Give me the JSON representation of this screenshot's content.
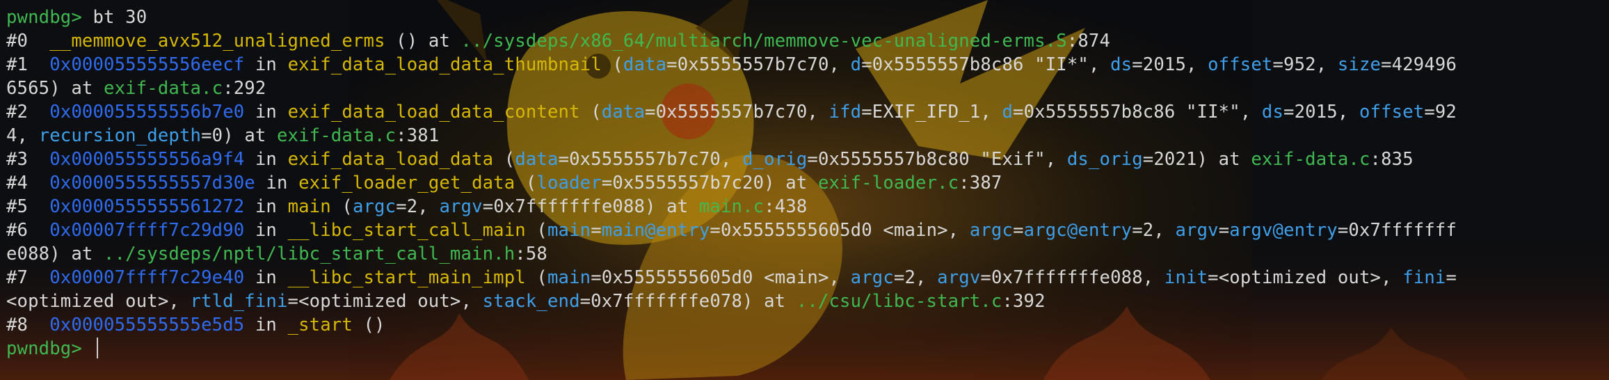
{
  "terminal": {
    "prompt": "pwndbg>",
    "command": "bt 30",
    "lines": [
      {
        "kind": "prompt",
        "segments": [
          {
            "t": "pwndbg>",
            "c": "pr"
          },
          {
            "t": " bt 30",
            "c": "w"
          }
        ]
      },
      {
        "kind": "frame",
        "segments": [
          {
            "t": "#0  ",
            "c": "w"
          },
          {
            "t": "__memmove_avx512_unaligned_erms",
            "c": "y"
          },
          {
            "t": " () at ",
            "c": "w"
          },
          {
            "t": "../sysdeps/x86_64/multiarch/memmove-vec-unaligned-erms.S",
            "c": "g"
          },
          {
            "t": ":874",
            "c": "w"
          }
        ]
      },
      {
        "kind": "frame",
        "segments": [
          {
            "t": "#1  ",
            "c": "w"
          },
          {
            "t": "0x000055555556eecf",
            "c": "a"
          },
          {
            "t": " in ",
            "c": "w"
          },
          {
            "t": "exif_data_load_data_thumbnail",
            "c": "y"
          },
          {
            "t": " (",
            "c": "w"
          },
          {
            "t": "data",
            "c": "b"
          },
          {
            "t": "=0x5555557b7c70, ",
            "c": "w"
          },
          {
            "t": "d",
            "c": "b"
          },
          {
            "t": "=0x5555557b8c86 \"II*\", ",
            "c": "w"
          },
          {
            "t": "ds",
            "c": "b"
          },
          {
            "t": "=2015, ",
            "c": "w"
          },
          {
            "t": "offset",
            "c": "b"
          },
          {
            "t": "=952, ",
            "c": "w"
          },
          {
            "t": "size",
            "c": "b"
          },
          {
            "t": "=429496",
            "c": "w"
          }
        ]
      },
      {
        "kind": "cont",
        "segments": [
          {
            "t": "6565) at ",
            "c": "w"
          },
          {
            "t": "exif-data.c",
            "c": "g"
          },
          {
            "t": ":292",
            "c": "w"
          }
        ]
      },
      {
        "kind": "frame",
        "segments": [
          {
            "t": "#2  ",
            "c": "w"
          },
          {
            "t": "0x000055555556b7e0",
            "c": "a"
          },
          {
            "t": " in ",
            "c": "w"
          },
          {
            "t": "exif_data_load_data_content",
            "c": "y"
          },
          {
            "t": " (",
            "c": "w"
          },
          {
            "t": "data",
            "c": "b"
          },
          {
            "t": "=0x5555557b7c70, ",
            "c": "w"
          },
          {
            "t": "ifd",
            "c": "b"
          },
          {
            "t": "=EXIF_IFD_1, ",
            "c": "w"
          },
          {
            "t": "d",
            "c": "b"
          },
          {
            "t": "=0x5555557b8c86 \"II*\", ",
            "c": "w"
          },
          {
            "t": "ds",
            "c": "b"
          },
          {
            "t": "=2015, ",
            "c": "w"
          },
          {
            "t": "offset",
            "c": "b"
          },
          {
            "t": "=92",
            "c": "w"
          }
        ]
      },
      {
        "kind": "cont",
        "segments": [
          {
            "t": "4, ",
            "c": "w"
          },
          {
            "t": "recursion_depth",
            "c": "b"
          },
          {
            "t": "=0) at ",
            "c": "w"
          },
          {
            "t": "exif-data.c",
            "c": "g"
          },
          {
            "t": ":381",
            "c": "w"
          }
        ]
      },
      {
        "kind": "frame",
        "segments": [
          {
            "t": "#3  ",
            "c": "w"
          },
          {
            "t": "0x000055555556a9f4",
            "c": "a"
          },
          {
            "t": " in ",
            "c": "w"
          },
          {
            "t": "exif_data_load_data",
            "c": "y"
          },
          {
            "t": " (",
            "c": "w"
          },
          {
            "t": "data",
            "c": "b"
          },
          {
            "t": "=0x5555557b7c70, ",
            "c": "w"
          },
          {
            "t": "d_orig",
            "c": "b"
          },
          {
            "t": "=0x5555557b8c80 \"Exif\", ",
            "c": "w"
          },
          {
            "t": "ds_orig",
            "c": "b"
          },
          {
            "t": "=2021) at ",
            "c": "w"
          },
          {
            "t": "exif-data.c",
            "c": "g"
          },
          {
            "t": ":835",
            "c": "w"
          }
        ]
      },
      {
        "kind": "frame",
        "segments": [
          {
            "t": "#4  ",
            "c": "w"
          },
          {
            "t": "0x0000555555557d30e",
            "c": "a"
          },
          {
            "t": " in ",
            "c": "w"
          },
          {
            "t": "exif_loader_get_data",
            "c": "y"
          },
          {
            "t": " (",
            "c": "w"
          },
          {
            "t": "loader",
            "c": "b"
          },
          {
            "t": "=0x5555557b7c20) at ",
            "c": "w"
          },
          {
            "t": "exif-loader.c",
            "c": "g"
          },
          {
            "t": ":387",
            "c": "w"
          }
        ]
      },
      {
        "kind": "frame",
        "segments": [
          {
            "t": "#5  ",
            "c": "w"
          },
          {
            "t": "0x0000555555561272",
            "c": "a"
          },
          {
            "t": " in ",
            "c": "w"
          },
          {
            "t": "main",
            "c": "y"
          },
          {
            "t": " (",
            "c": "w"
          },
          {
            "t": "argc",
            "c": "b"
          },
          {
            "t": "=2, ",
            "c": "w"
          },
          {
            "t": "argv",
            "c": "b"
          },
          {
            "t": "=0x7fffffffe088) at ",
            "c": "w"
          },
          {
            "t": "main.c",
            "c": "g"
          },
          {
            "t": ":438",
            "c": "w"
          }
        ]
      },
      {
        "kind": "frame",
        "segments": [
          {
            "t": "#6  ",
            "c": "w"
          },
          {
            "t": "0x00007ffff7c29d90",
            "c": "a"
          },
          {
            "t": " in ",
            "c": "w"
          },
          {
            "t": "__libc_start_call_main",
            "c": "y"
          },
          {
            "t": " (",
            "c": "w"
          },
          {
            "t": "main",
            "c": "b"
          },
          {
            "t": "=",
            "c": "w"
          },
          {
            "t": "main@entry",
            "c": "b"
          },
          {
            "t": "=0x5555555605d0 <main>, ",
            "c": "w"
          },
          {
            "t": "argc",
            "c": "b"
          },
          {
            "t": "=",
            "c": "w"
          },
          {
            "t": "argc@entry",
            "c": "b"
          },
          {
            "t": "=2, ",
            "c": "w"
          },
          {
            "t": "argv",
            "c": "b"
          },
          {
            "t": "=",
            "c": "w"
          },
          {
            "t": "argv@entry",
            "c": "b"
          },
          {
            "t": "=0x7fffffff",
            "c": "w"
          }
        ]
      },
      {
        "kind": "cont",
        "segments": [
          {
            "t": "e088) at ",
            "c": "w"
          },
          {
            "t": "../sysdeps/nptl/libc_start_call_main.h",
            "c": "g"
          },
          {
            "t": ":58",
            "c": "w"
          }
        ]
      },
      {
        "kind": "frame",
        "segments": [
          {
            "t": "#7  ",
            "c": "w"
          },
          {
            "t": "0x00007ffff7c29e40",
            "c": "a"
          },
          {
            "t": " in ",
            "c": "w"
          },
          {
            "t": "__libc_start_main_impl",
            "c": "y"
          },
          {
            "t": " (",
            "c": "w"
          },
          {
            "t": "main",
            "c": "b"
          },
          {
            "t": "=0x5555555605d0 <main>, ",
            "c": "w"
          },
          {
            "t": "argc",
            "c": "b"
          },
          {
            "t": "=2, ",
            "c": "w"
          },
          {
            "t": "argv",
            "c": "b"
          },
          {
            "t": "=0x7fffffffe088, ",
            "c": "w"
          },
          {
            "t": "init",
            "c": "b"
          },
          {
            "t": "=<optimized out>, ",
            "c": "w"
          },
          {
            "t": "fini",
            "c": "b"
          },
          {
            "t": "=",
            "c": "w"
          }
        ]
      },
      {
        "kind": "cont",
        "segments": [
          {
            "t": "<optimized out>, ",
            "c": "w"
          },
          {
            "t": "rtld_fini",
            "c": "b"
          },
          {
            "t": "=<optimized out>, ",
            "c": "w"
          },
          {
            "t": "stack_end",
            "c": "b"
          },
          {
            "t": "=0x7fffffffe078) at ",
            "c": "w"
          },
          {
            "t": "../csu/libc-start.c",
            "c": "g"
          },
          {
            "t": ":392",
            "c": "w"
          }
        ]
      },
      {
        "kind": "frame",
        "segments": [
          {
            "t": "#8  ",
            "c": "w"
          },
          {
            "t": "0x000055555555e5d5",
            "c": "a"
          },
          {
            "t": " in ",
            "c": "w"
          },
          {
            "t": "_start",
            "c": "y"
          },
          {
            "t": " ()",
            "c": "w"
          }
        ]
      },
      {
        "kind": "prompt",
        "segments": [
          {
            "t": "pwndbg>",
            "c": "pr"
          },
          {
            "t": " ",
            "c": "w"
          }
        ],
        "cursor": true
      }
    ]
  },
  "colors": {
    "prompt": "#3fb950",
    "function": "#d7b800",
    "argument": "#3ea0ea",
    "address": "#2f6cf2",
    "path": "#3fb950",
    "text": "#d8d8d8"
  },
  "wallpaper_icon": "pikachu-wallpaper"
}
